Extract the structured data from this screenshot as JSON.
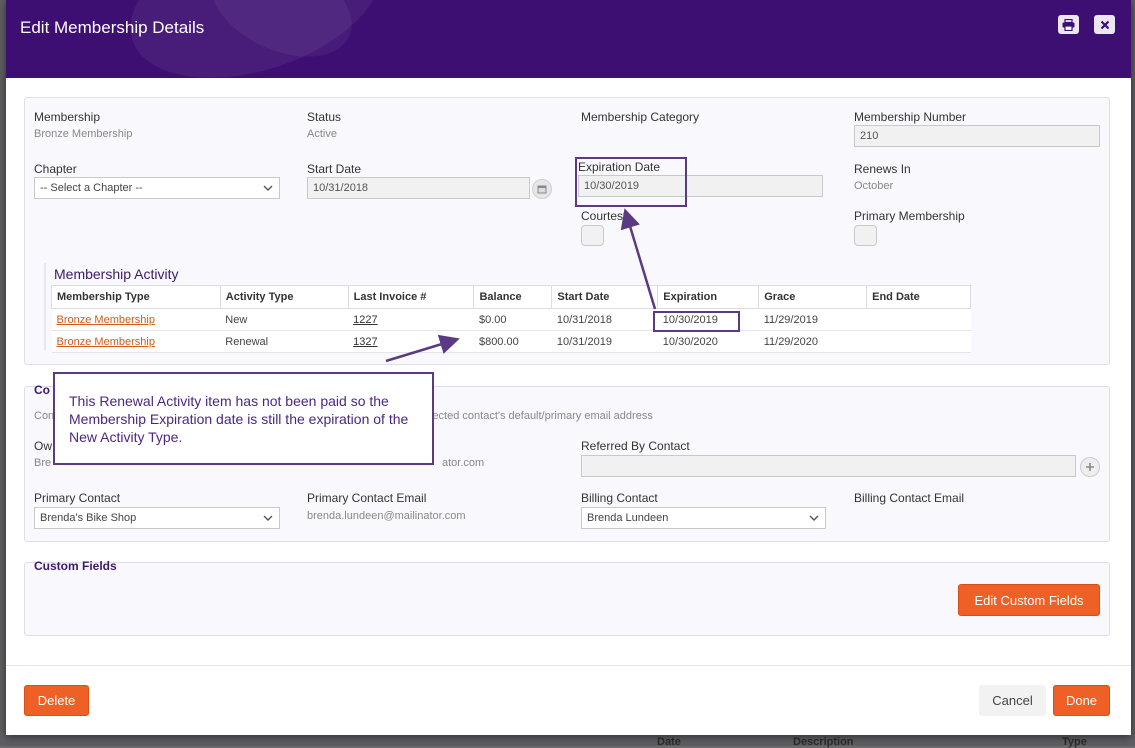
{
  "backdrop": {
    "col_date": "Date",
    "col_description": "Description",
    "col_type": "Type"
  },
  "header": {
    "title": "Edit Membership Details",
    "print_icon": "print-icon",
    "close_icon": "close-icon"
  },
  "details": {
    "membership_label": "Membership",
    "membership_value": "Bronze Membership",
    "status_label": "Status",
    "status_value": "Active",
    "category_label": "Membership Category",
    "number_label": "Membership Number",
    "number_value": "210",
    "chapter_label": "Chapter",
    "chapter_value": "-- Select a Chapter --",
    "start_label": "Start Date",
    "start_value": "10/31/2018",
    "expiration_label": "Expiration Date",
    "expiration_value": "10/30/2019",
    "renews_label": "Renews In",
    "renews_value": "October",
    "courtesy_label": "Courtesy",
    "primary_membership_label": "Primary Membership"
  },
  "activity": {
    "title": "Membership Activity",
    "columns": [
      "Membership Type",
      "Activity Type",
      "Last Invoice #",
      "Balance",
      "Start Date",
      "Expiration",
      "Grace",
      "End Date"
    ],
    "rows": [
      {
        "type": "Bronze Membership",
        "activity": "New",
        "invoice": "1227",
        "balance": "$0.00",
        "start": "10/31/2018",
        "expiration": "10/30/2019",
        "grace": "11/29/2019",
        "end": ""
      },
      {
        "type": "Bronze Membership",
        "activity": "Renewal",
        "invoice": "1327",
        "balance": "$800.00",
        "start": "10/31/2019",
        "expiration": "10/30/2020",
        "grace": "11/29/2020",
        "end": ""
      }
    ]
  },
  "contacts": {
    "section_title": "Co",
    "hint_prefix": "Con",
    "hint_text": "lected contact's default/primary email address",
    "owner_label": "Ow",
    "owner_value_prefix": "Bre",
    "owner_email_suffix": "ator.com",
    "referred_label": "Referred By Contact",
    "primary_contact_label": "Primary Contact",
    "primary_contact_value": "Brenda's Bike Shop",
    "primary_email_label": "Primary Contact Email",
    "primary_email_value": "brenda.lundeen@mailinator.com",
    "billing_label": "Billing Contact",
    "billing_value": "Brenda Lundeen",
    "billing_email_label": "Billing Contact Email"
  },
  "custom_fields": {
    "title": "Custom Fields",
    "edit_button": "Edit Custom Fields"
  },
  "callout": {
    "text": "This Renewal Activity item has not been paid so the Membership Expiration date is still the expiration of the New Activity Type."
  },
  "footer": {
    "delete": "Delete",
    "cancel": "Cancel",
    "done": "Done"
  },
  "colors": {
    "header": "#3d0f72",
    "accent": "#ee6026",
    "link": "#d65a17",
    "annotation": "#5a3a82"
  }
}
